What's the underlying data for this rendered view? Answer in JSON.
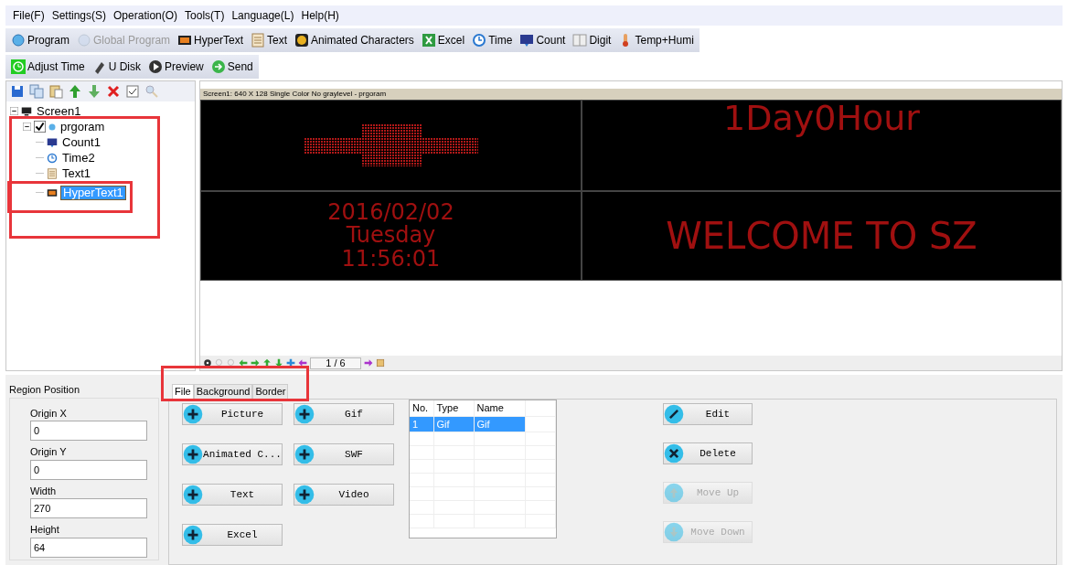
{
  "menu": [
    "File(F)",
    "Settings(S)",
    "Operation(O)",
    "Tools(T)",
    "Language(L)",
    "Help(H)"
  ],
  "toolbar": [
    {
      "label": "Program",
      "disabled": false
    },
    {
      "label": "Global Program",
      "disabled": true
    },
    {
      "label": "HyperText",
      "disabled": false
    },
    {
      "label": "Text",
      "disabled": false
    },
    {
      "label": "Animated Characters",
      "disabled": false
    },
    {
      "label": "Excel",
      "disabled": false
    },
    {
      "label": "Time",
      "disabled": false
    },
    {
      "label": "Count",
      "disabled": false
    },
    {
      "label": "Digit",
      "disabled": false
    },
    {
      "label": "Temp+Humi",
      "disabled": false
    }
  ],
  "toolbar2": [
    "Adjust Time",
    "U Disk",
    "Preview",
    "Send"
  ],
  "tree": [
    {
      "label": "Screen1",
      "expanded": true,
      "children": [
        {
          "label": "prgoram",
          "checked": true,
          "expanded": true,
          "selected": false,
          "children": [
            {
              "label": "Count1",
              "selected": false
            },
            {
              "label": "Time2",
              "selected": false
            },
            {
              "label": "Text1",
              "selected": false
            },
            {
              "label": "HyperText1",
              "selected": true
            }
          ]
        }
      ]
    }
  ],
  "preview": {
    "header": "Screen1: 640 X 128  Single Color No graylevel - prgoram",
    "regions": [
      {
        "kind": "arrow"
      },
      {
        "kind": "text",
        "lines": [
          "1Day0Hour"
        ]
      },
      {
        "kind": "text",
        "lines": [
          "2016/02/02",
          "Tuesday",
          "11:56:01"
        ]
      },
      {
        "kind": "text",
        "lines": [
          "WELCOME TO SZ"
        ]
      }
    ],
    "page": "1 / 6"
  },
  "region_position": {
    "title": "Region Position",
    "fields": [
      {
        "label": "Origin X",
        "value": "0"
      },
      {
        "label": "Origin Y",
        "value": "0"
      },
      {
        "label": "Width",
        "value": "270"
      },
      {
        "label": "Height",
        "value": "64"
      }
    ]
  },
  "tabs": [
    {
      "label": "File",
      "selected": true
    },
    {
      "label": "Background",
      "selected": false
    },
    {
      "label": "Border",
      "selected": false
    }
  ],
  "add_buttons": [
    "Picture",
    "Gif",
    "Animated C...",
    "SWF",
    "Text",
    "Video",
    "Excel"
  ],
  "table": {
    "columns": [
      "No.",
      "Type",
      "Name"
    ],
    "rows": [
      {
        "cells": [
          "1",
          "Gif",
          "Gif"
        ],
        "selected": true
      }
    ]
  },
  "actions": [
    {
      "label": "Edit",
      "kind": "edit",
      "disabled": false
    },
    {
      "label": "Delete",
      "kind": "delete",
      "disabled": false
    },
    {
      "label": "Move Up",
      "kind": "up",
      "disabled": true
    },
    {
      "label": "Move Down",
      "kind": "down",
      "disabled": true
    }
  ]
}
